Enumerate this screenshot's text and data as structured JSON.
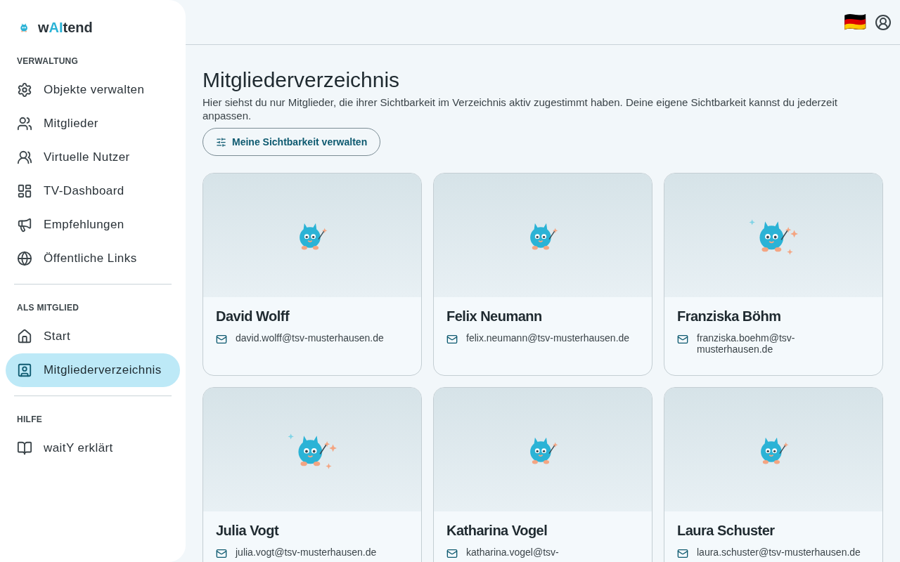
{
  "brand": {
    "prefix": "w",
    "accent": "AI",
    "suffix": "tend"
  },
  "sidebar": {
    "sections": [
      {
        "heading": "VERWALTUNG",
        "items": [
          {
            "label": "Objekte verwalten",
            "selected": false
          },
          {
            "label": "Mitglieder",
            "selected": false
          },
          {
            "label": "Virtuelle Nutzer",
            "selected": false
          },
          {
            "label": "TV-Dashboard",
            "selected": false
          },
          {
            "label": "Empfehlungen",
            "selected": false
          },
          {
            "label": "Öffentliche Links",
            "selected": false
          }
        ]
      },
      {
        "heading": "ALS MITGLIED",
        "items": [
          {
            "label": "Start",
            "selected": false
          },
          {
            "label": "Mitgliederverzeichnis",
            "selected": true
          }
        ]
      },
      {
        "heading": "HILFE",
        "items": [
          {
            "label": "waitY erklärt",
            "selected": false
          }
        ]
      }
    ]
  },
  "topbar": {
    "flag": "🇩🇪"
  },
  "page": {
    "title": "Mitgliederverzeichnis",
    "description": "Hier siehst du nur Mitglieder, die ihrer Sichtbarkeit im Verzeichnis aktiv zugestimmt haben. Deine eigene Sichtbarkeit kannst du jederzeit anpassen.",
    "button": "Meine Sichtbarkeit verwalten"
  },
  "members": [
    {
      "name": "David Wolff",
      "email": "david.wolff@tsv-musterhausen.de",
      "sparkles": false
    },
    {
      "name": "Felix Neumann",
      "email": "felix.neumann@tsv-musterhausen.de",
      "sparkles": false
    },
    {
      "name": "Franziska Böhm",
      "email": "franziska.boehm@tsv-musterhausen.de",
      "sparkles": true
    },
    {
      "name": "Julia Vogt",
      "email": "julia.vogt@tsv-musterhausen.de",
      "sparkles": true
    },
    {
      "name": "Katharina Vogel",
      "email": "katharina.vogel@tsv-",
      "sparkles": false
    },
    {
      "name": "Laura Schuster",
      "email": "laura.schuster@tsv-musterhausen.de",
      "sparkles": false
    }
  ]
}
